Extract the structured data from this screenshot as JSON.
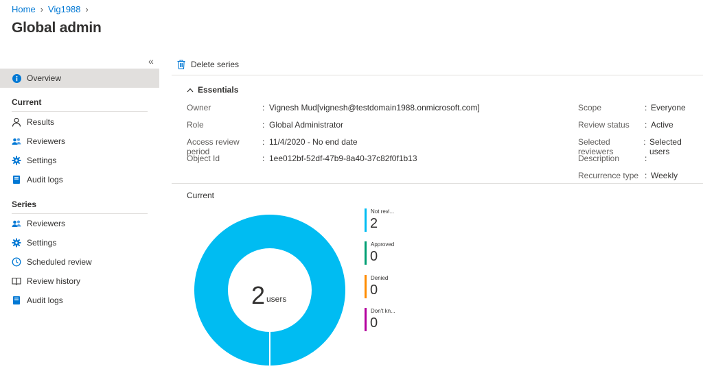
{
  "breadcrumb": {
    "home": "Home",
    "item": "Vig1988"
  },
  "page": {
    "title": "Global admin"
  },
  "sidebar": {
    "collapse_glyph": "«",
    "overview": {
      "label": "Overview",
      "icon": "info-icon"
    },
    "current_section": "Current",
    "current_items": [
      {
        "label": "Results",
        "icon": "person-icon"
      },
      {
        "label": "Reviewers",
        "icon": "people-icon"
      },
      {
        "label": "Settings",
        "icon": "gear-icon"
      },
      {
        "label": "Audit logs",
        "icon": "log-book-icon"
      }
    ],
    "series_section": "Series",
    "series_items": [
      {
        "label": "Reviewers",
        "icon": "people-icon"
      },
      {
        "label": "Settings",
        "icon": "gear-icon"
      },
      {
        "label": "Scheduled review",
        "icon": "clock-icon"
      },
      {
        "label": "Review history",
        "icon": "book-icon"
      },
      {
        "label": "Audit logs",
        "icon": "log-book-icon"
      }
    ]
  },
  "toolbar": {
    "delete_label": "Delete series",
    "delete_icon": "trash-icon"
  },
  "essentials": {
    "header": "Essentials",
    "left": [
      {
        "label": "Owner",
        "value": "Vignesh Mud[vignesh@testdomain1988.onmicrosoft.com]"
      },
      {
        "label": "Role",
        "value": "Global Administrator"
      },
      {
        "label": "Access review period",
        "value": "11/4/2020 - No end date"
      },
      {
        "label": "Object Id",
        "value": "1ee012bf-52df-47b9-8a40-37c82f0f1b13"
      }
    ],
    "right": [
      {
        "label": "Scope",
        "value": "Everyone"
      },
      {
        "label": "Review status",
        "value": "Active"
      },
      {
        "label": "Selected reviewers",
        "value": "Selected users"
      },
      {
        "label": "Description",
        "value": ""
      },
      {
        "label": "Recurrence type",
        "value": "Weekly"
      }
    ]
  },
  "current": {
    "title": "Current",
    "donut": {
      "total": "2",
      "unit": "users",
      "color": "#00bcf2"
    },
    "legend": [
      {
        "label": "Not revi...",
        "value": "2",
        "color": "#00bcf2"
      },
      {
        "label": "Approved",
        "value": "0",
        "color": "#009e73"
      },
      {
        "label": "Denied",
        "value": "0",
        "color": "#ff8c00"
      },
      {
        "label": "Don't kn...",
        "value": "0",
        "color": "#b4009e"
      }
    ]
  }
}
